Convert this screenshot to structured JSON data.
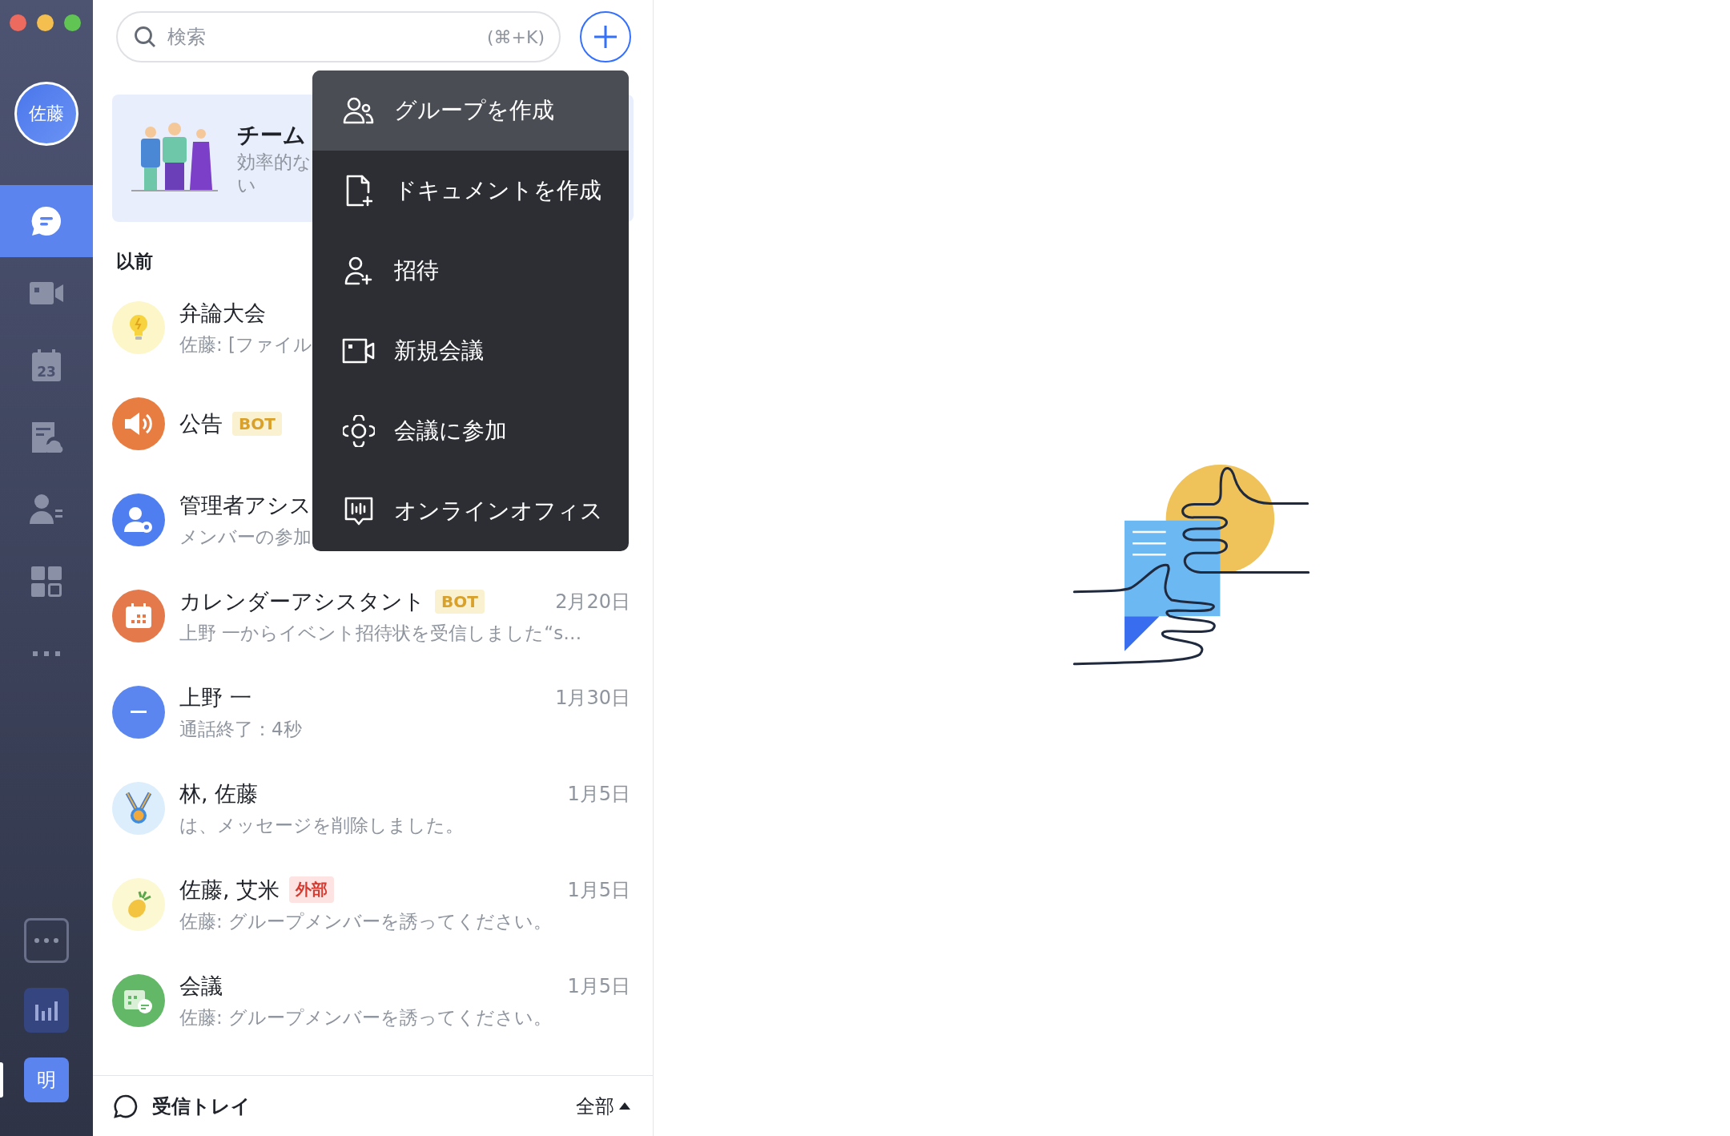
{
  "sidebar": {
    "avatar": "佐藤",
    "items": [
      {
        "kind": "chat",
        "selected": true
      },
      {
        "kind": "video",
        "selected": false
      },
      {
        "kind": "calendar",
        "label": "23",
        "selected": false
      },
      {
        "kind": "docs",
        "selected": false
      },
      {
        "kind": "contacts",
        "selected": false
      },
      {
        "kind": "apps",
        "selected": false
      },
      {
        "kind": "more",
        "selected": false
      }
    ],
    "tools": [
      {
        "kind": "more-box"
      },
      {
        "kind": "chart"
      }
    ],
    "workspaces": [
      {
        "label": "明",
        "selected": true
      }
    ]
  },
  "search": {
    "placeholder": "検索",
    "shortcut": "(⌘+K)"
  },
  "banner": {
    "title": "チーム",
    "subtitle_lines": [
      "効率的な",
      "い"
    ]
  },
  "section": "以前",
  "chats": [
    {
      "kind": "bulb",
      "color": "#fcf6c8",
      "name": "弁論大会",
      "preview": "佐藤: [ファイル"
    },
    {
      "kind": "speaker",
      "color": "#e77d41",
      "name": "公告",
      "badge": {
        "kind": "bot",
        "text": "BOT"
      }
    },
    {
      "kind": "admin",
      "color": "#4f7ef0",
      "name": "管理者アシス",
      "preview": "メンバーの参加"
    },
    {
      "kind": "calendar",
      "color": "#e4794c",
      "name": "カレンダーアシスタント",
      "badge": {
        "kind": "bot",
        "text": "BOT"
      },
      "preview": "上野 一からイベント招待状を受信しました“s…",
      "date": "2月20日"
    },
    {
      "kind": "minus",
      "color": "#5b86f0",
      "name": "上野 一",
      "preview": "通話終了：4秒",
      "date": "1月30日"
    },
    {
      "kind": "medal",
      "color": "#dcedfb",
      "name": "林, 佐藤",
      "preview": "は、メッセージを削除しました。",
      "date": "1月5日"
    },
    {
      "kind": "pineapple",
      "color": "#fcf8d2",
      "name": "佐藤, 艾米",
      "badge": {
        "kind": "external",
        "text": "外部"
      },
      "preview": "佐藤: グループメンバーを誘ってください。",
      "date": "1月5日"
    },
    {
      "kind": "meeting",
      "color": "#62b867",
      "name": "会議",
      "preview": "佐藤: グループメンバーを誘ってください。",
      "date": "1月5日"
    }
  ],
  "footer": {
    "label": "受信トレイ",
    "filter": "全部"
  },
  "menu": [
    {
      "kind": "group",
      "label": "グループを作成",
      "highlighted": true
    },
    {
      "kind": "document",
      "label": "ドキュメントを作成",
      "highlighted": false
    },
    {
      "kind": "invite",
      "label": "招待",
      "highlighted": false
    },
    {
      "kind": "meeting",
      "label": "新規会議",
      "highlighted": false
    },
    {
      "kind": "join",
      "label": "会議に参加",
      "highlighted": false
    },
    {
      "kind": "office",
      "label": "オンラインオフィス",
      "highlighted": false
    }
  ]
}
